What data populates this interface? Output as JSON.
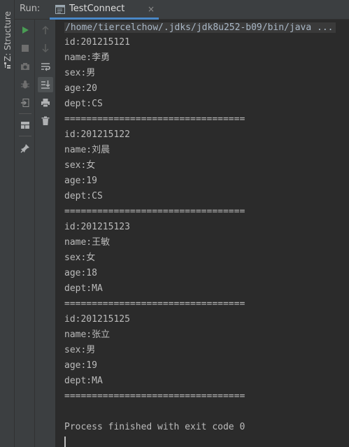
{
  "sidebar": {
    "structure_label": "Z: Structure",
    "icon": "structure-icon"
  },
  "header": {
    "run_label": "Run:",
    "tab": {
      "title": "TestConnect",
      "icon": "console-tab-icon",
      "close_icon": "close-icon",
      "close_glyph": "×"
    }
  },
  "toolbar": {
    "accent_run": "#499c54",
    "primary": [
      "run-icon",
      "stop-icon",
      "camera-icon",
      "debug-bug-icon",
      "exit-icon",
      "layout-icon",
      "pin-icon"
    ],
    "secondary": [
      "arrow-up-icon",
      "arrow-down-icon",
      "soft-wrap-icon",
      "scroll-to-end-icon",
      "print-icon",
      "trash-icon"
    ]
  },
  "console": {
    "command": "/home/tiercelchow/.jdks/jdk8u252-b09/bin/java ...",
    "lines": [
      "id:201215121",
      "name:李勇",
      "sex:男",
      "age:20",
      "dept:CS",
      "=================================",
      "id:201215122",
      "name:刘晨",
      "sex:女",
      "age:19",
      "dept:CS",
      "=================================",
      "id:201215123",
      "name:王敏",
      "sex:女",
      "age:18",
      "dept:MA",
      "=================================",
      "id:201215125",
      "name:张立",
      "sex:男",
      "age:19",
      "dept:MA",
      "=================================",
      "",
      "Process finished with exit code 0"
    ]
  }
}
